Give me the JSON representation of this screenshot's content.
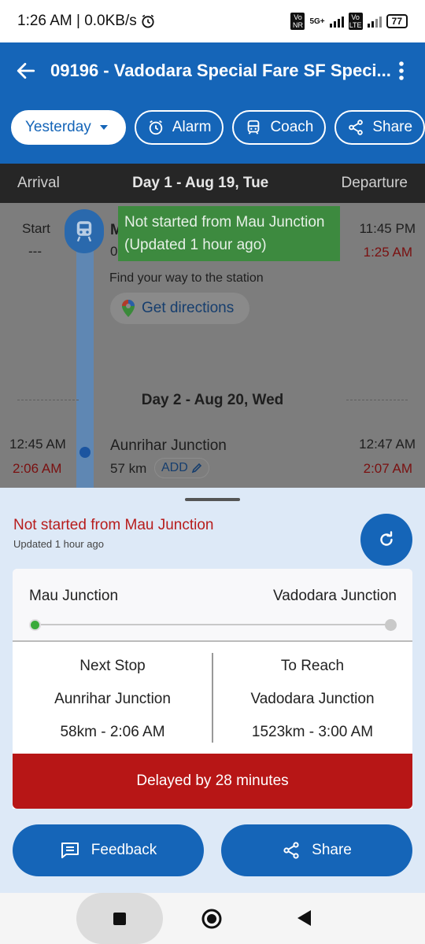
{
  "status_bar": {
    "time": "1:26 AM | 0.0KB/s",
    "net1": "Vo NR",
    "net2": "5G+",
    "net3": "Vo LTE",
    "battery": "77"
  },
  "app_bar": {
    "title": "09196 - Vadodara Special Fare SF Speci...",
    "day_selector": "Yesterday",
    "alarm_label": "Alarm",
    "coach_label": "Coach",
    "share_label": "Share"
  },
  "day_strip": {
    "arrival": "Arrival",
    "day": "Day 1 - Aug 19, Tue",
    "departure": "Departure"
  },
  "timeline": {
    "start_label": "Start",
    "start_dash": "---",
    "stop1_name_partial": "M",
    "stop1_dist_partial": "0",
    "stop1_sched": "11:45 PM",
    "stop1_actual": "1:25 AM",
    "toast_line1": "Not started from Mau Junction",
    "toast_line2": "(Updated 1 hour ago)",
    "find_way": "Find your way to the station",
    "directions": "Get directions",
    "day2": "Day 2 - Aug 20, Wed",
    "stop2_arr_sched": "12:45 AM",
    "stop2_arr_actual": "2:06 AM",
    "stop2_name": "Aunrihar Junction",
    "stop2_dist": "57 km",
    "stop2_add": "ADD",
    "stop2_dep_sched": "12:47 AM",
    "stop2_dep_actual": "2:07 AM"
  },
  "sheet": {
    "status": "Not started from Mau Junction",
    "updated": "Updated 1 hour ago",
    "from": "Mau Junction",
    "to": "Vadodara Junction",
    "next_stop_label": "Next Stop",
    "next_stop_name": "Aunrihar Junction",
    "next_stop_info": "58km - 2:06 AM",
    "to_reach_label": "To Reach",
    "to_reach_name": "Vadodara Junction",
    "to_reach_info": "1523km - 3:00 AM",
    "delay": "Delayed by 28 minutes",
    "feedback_label": "Feedback",
    "share_label": "Share"
  },
  "colors": {
    "primary": "#1565b8",
    "delay_red": "#b71616",
    "status_red": "#b71c1c",
    "toast_green": "#3d8a3f"
  }
}
